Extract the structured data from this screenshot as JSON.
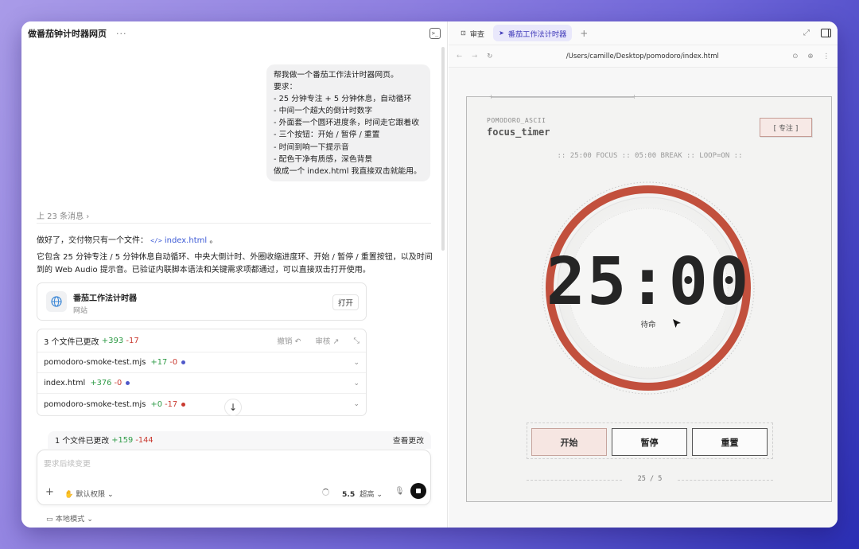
{
  "left": {
    "title": "做番茄钟计时器网页",
    "more": "···",
    "user_message": [
      "帮我做一个番茄工作法计时器网页。",
      "要求：",
      "- 25 分钟专注 + 5 分钟休息，自动循环",
      "- 中间一个超大的倒计时数字",
      "- 外面套一个圆环进度条，时间走它跟着收",
      "- 三个按钮：开始 / 暂停 / 重置",
      "- 时间到响一下提示音",
      "- 配色干净有质感，深色背景",
      "做成一个 index.html 我直接双击就能用。"
    ],
    "previous_messages": "上 23 条消息",
    "reply_intro": "做好了，交付物只有一个文件：",
    "reply_file": "index.html",
    "reply_code_glyph": "</>",
    "reply_end": "。",
    "reply_body": "它包含 25 分钟专注 / 5 分钟休息自动循环、中央大倒计时、外圈收缩进度环、开始 / 暂停 / 重置按钮，以及时间到的 Web Audio 提示音。已验证内联脚本语法和关键需求项都通过，可以直接双击打开使用。",
    "site_card": {
      "name": "番茄工作法计时器",
      "type": "网站",
      "open": "打开"
    },
    "changes": {
      "summary": "3 个文件已更改",
      "added": "+393",
      "removed": "-17",
      "undo": "撤销 ↶",
      "review": "审核 ↗",
      "files": [
        {
          "name": "pomodoro-smoke-test.mjs",
          "added": "+17",
          "removed": "-0",
          "dot": "#4f58c9"
        },
        {
          "name": "index.html",
          "added": "+376",
          "removed": "-0",
          "dot": "#4f58c9"
        },
        {
          "name": "pomodoro-smoke-test.mjs",
          "added": "+0",
          "removed": "-17",
          "dot": "#c9392f"
        }
      ]
    },
    "one_change": {
      "summary": "1 个文件已更改",
      "added": "+159",
      "removed": "-144",
      "view": "查看更改"
    },
    "composer": {
      "placeholder": "要求后续变更",
      "permission": "默认权限",
      "model": "5.5",
      "model_level": "超高"
    },
    "local_mode": "本地模式"
  },
  "right": {
    "tabs": [
      {
        "label": "审查",
        "active": false
      },
      {
        "label": "番茄工作法计时器",
        "active": true
      }
    ],
    "url": "/Users/camille/Desktop/pomodoro/index.html",
    "app": {
      "label": "POMODORO_ASCII",
      "title": "focus_timer",
      "mode": "[ 专注 ]",
      "status_line": ":: 25:00 FOCUS :: 05:00 BREAK :: LOOP=ON ::",
      "time": "25:00",
      "state": "待命",
      "progress": 1.0,
      "buttons": {
        "start": "开始",
        "pause": "暂停",
        "reset": "重置"
      },
      "round": "25 / 5"
    },
    "colors": {
      "ring": "#c2503d",
      "accent_tab": "#3c36b8"
    }
  }
}
